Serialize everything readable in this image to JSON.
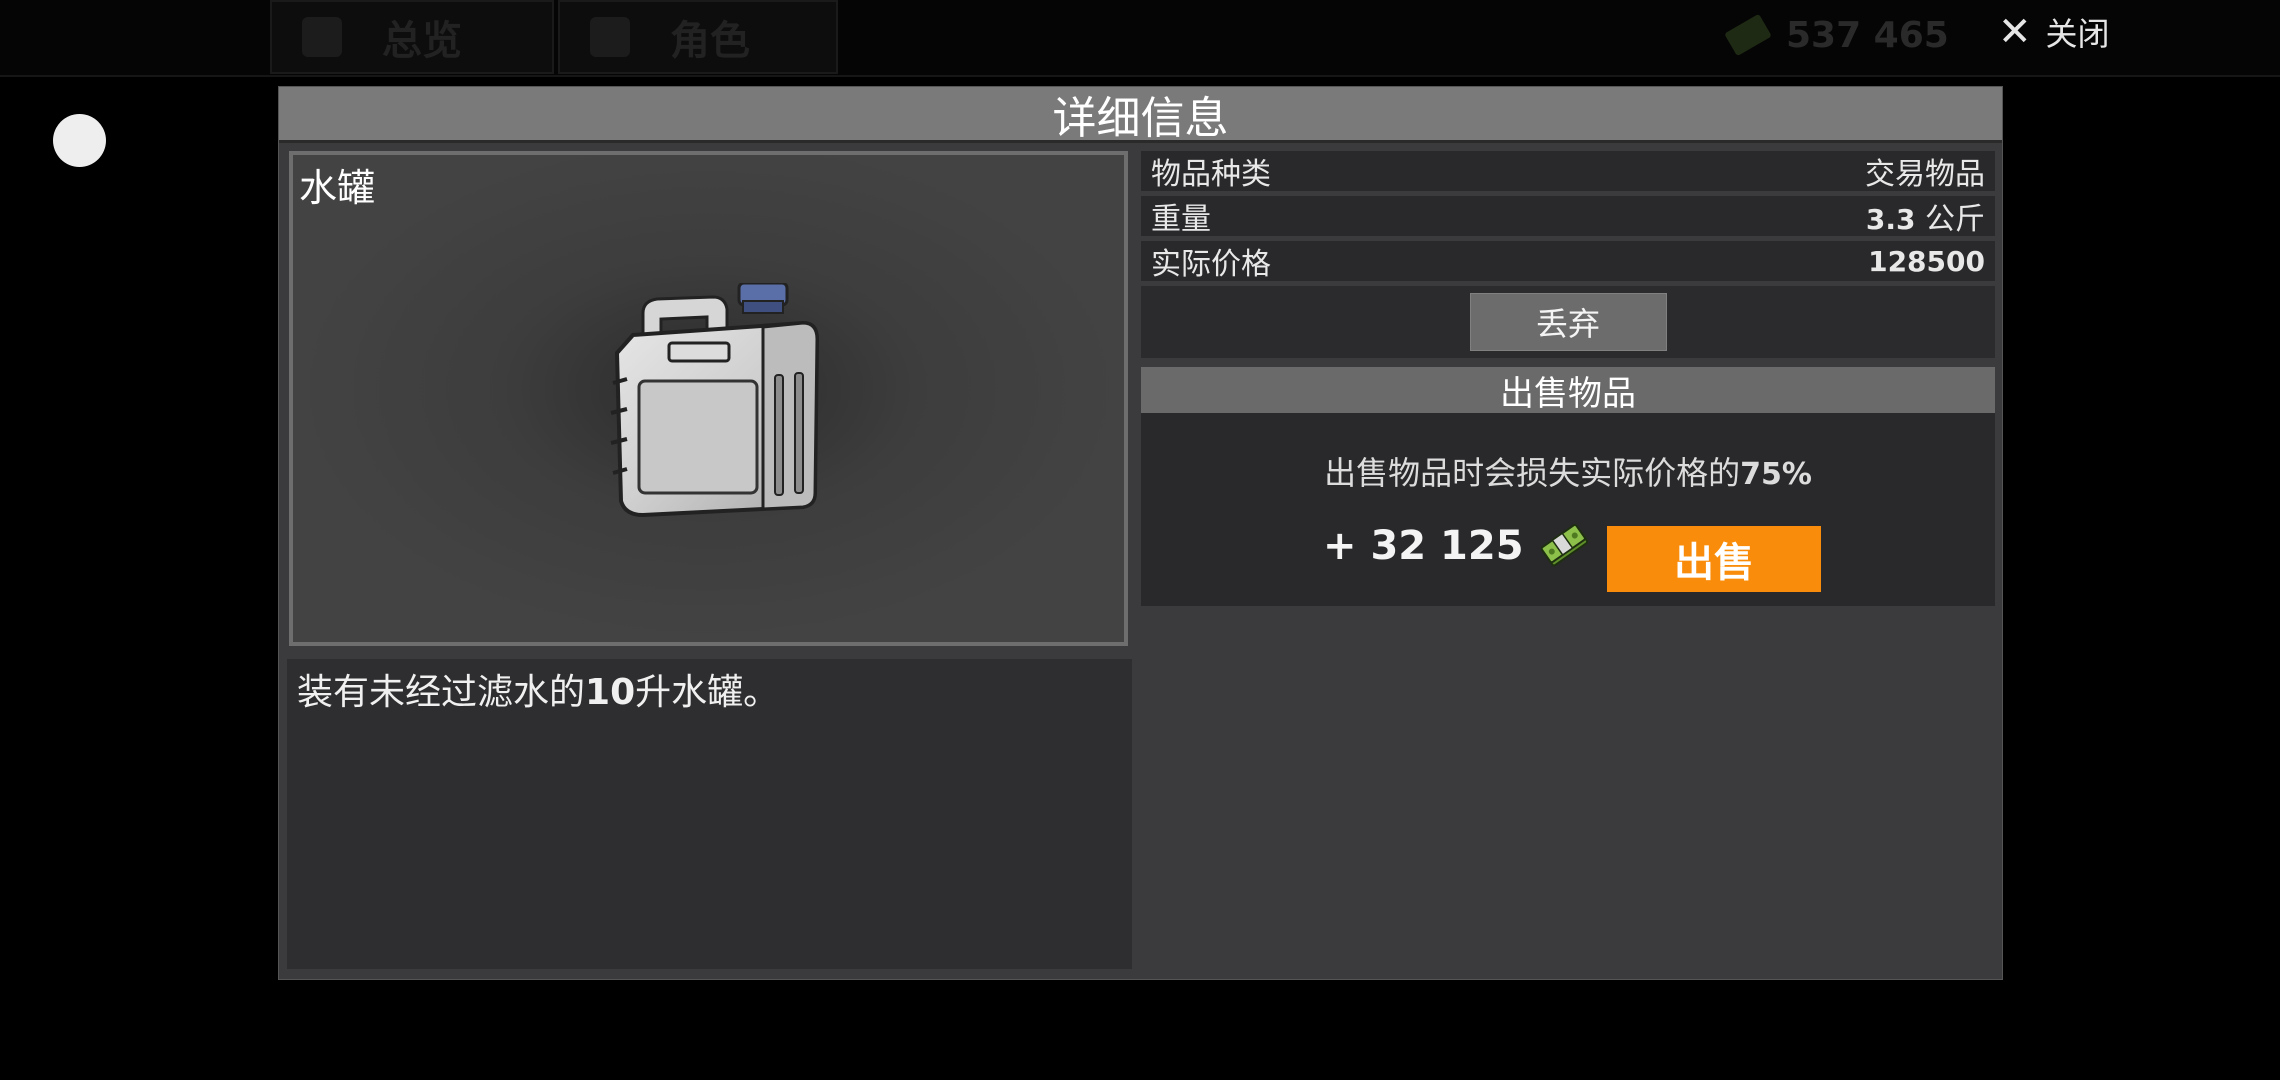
{
  "nav": {
    "tabs": [
      {
        "label": "总览"
      },
      {
        "label": "角色"
      }
    ],
    "money": "537 465",
    "close_label": "关闭"
  },
  "modal": {
    "title": "详细信息",
    "item_name": "水罐",
    "description_parts": [
      "装有未经过滤水的",
      "10",
      "升水罐。"
    ],
    "info": [
      {
        "label": "物品种类",
        "value": "交易物品"
      },
      {
        "label": "重量",
        "value_num": "3.3",
        "value_unit": "公斤"
      },
      {
        "label": "实际价格",
        "value": "128500"
      }
    ],
    "discard_label": "丢弃",
    "sell": {
      "header": "出售物品",
      "note": "出售物品时会损失实际价格的",
      "note_percent": "75%",
      "amount": "+ 32 125",
      "button": "出售"
    }
  },
  "colors": {
    "sell_button": "#f98c0b",
    "modal_bg": "#3b3b3d",
    "title_bar": "#7a7a7a"
  },
  "icons": [
    "close-icon",
    "cash-icon",
    "jerrycan-image"
  ]
}
